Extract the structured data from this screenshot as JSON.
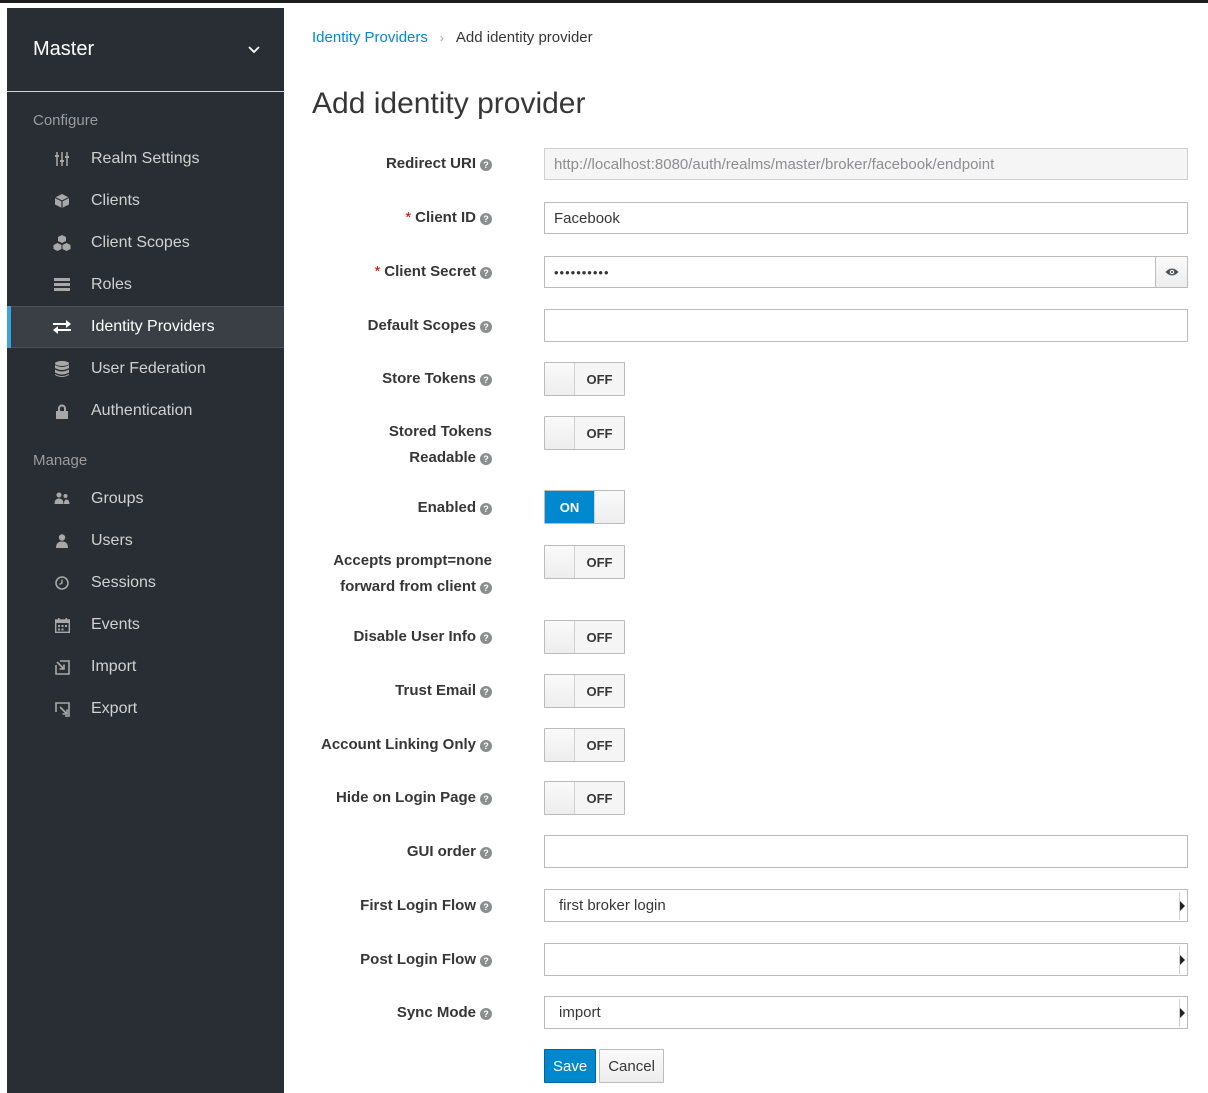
{
  "realm": {
    "name": "Master"
  },
  "sidebar": {
    "configure_title": "Configure",
    "configure_items": [
      {
        "label": "Realm Settings",
        "icon": "sliders-icon"
      },
      {
        "label": "Clients",
        "icon": "cube-icon"
      },
      {
        "label": "Client Scopes",
        "icon": "cubes-icon"
      },
      {
        "label": "Roles",
        "icon": "roles-icon"
      },
      {
        "label": "Identity Providers",
        "icon": "exchange-icon",
        "active": true
      },
      {
        "label": "User Federation",
        "icon": "database-icon"
      },
      {
        "label": "Authentication",
        "icon": "lock-icon"
      }
    ],
    "manage_title": "Manage",
    "manage_items": [
      {
        "label": "Groups",
        "icon": "users-icon"
      },
      {
        "label": "Users",
        "icon": "user-icon"
      },
      {
        "label": "Sessions",
        "icon": "clock-icon"
      },
      {
        "label": "Events",
        "icon": "calendar-icon"
      },
      {
        "label": "Import",
        "icon": "import-icon"
      },
      {
        "label": "Export",
        "icon": "export-icon"
      }
    ]
  },
  "breadcrumb": {
    "link": "Identity Providers",
    "current": "Add identity provider"
  },
  "page": {
    "title": "Add identity provider"
  },
  "form": {
    "redirect_uri": {
      "label": "Redirect URI",
      "value": "http://localhost:8080/auth/realms/master/broker/facebook/endpoint"
    },
    "client_id": {
      "label": "Client ID",
      "value": "Facebook"
    },
    "client_secret": {
      "label": "Client Secret",
      "value": "••••••••••"
    },
    "default_scopes": {
      "label": "Default Scopes",
      "value": ""
    },
    "store_tokens": {
      "label": "Store Tokens",
      "state": "OFF"
    },
    "stored_tokens_readable": {
      "label_line1": "Stored Tokens",
      "label_line2": "Readable",
      "state": "OFF"
    },
    "enabled": {
      "label": "Enabled",
      "state": "ON"
    },
    "accepts_prompt": {
      "label_line1": "Accepts prompt=none",
      "label_line2": "forward from client",
      "state": "OFF"
    },
    "disable_user_info": {
      "label": "Disable User Info",
      "state": "OFF"
    },
    "trust_email": {
      "label": "Trust Email",
      "state": "OFF"
    },
    "account_linking_only": {
      "label": "Account Linking Only",
      "state": "OFF"
    },
    "hide_on_login_page": {
      "label": "Hide on Login Page",
      "state": "OFF"
    },
    "gui_order": {
      "label": "GUI order",
      "value": ""
    },
    "first_login_flow": {
      "label": "First Login Flow",
      "value": "first broker login"
    },
    "post_login_flow": {
      "label": "Post Login Flow",
      "value": ""
    },
    "sync_mode": {
      "label": "Sync Mode",
      "value": "import"
    },
    "save_label": "Save",
    "cancel_label": "Cancel"
  },
  "colors": {
    "sidebar_bg": "#292e34",
    "accent": "#0088ce",
    "active_marker": "#39a5dc"
  }
}
